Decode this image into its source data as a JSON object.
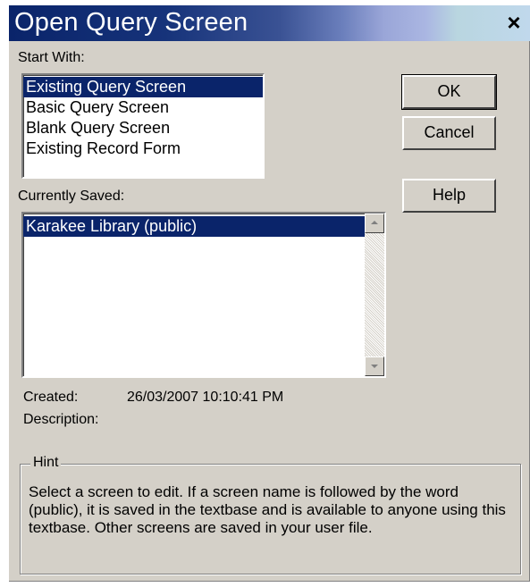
{
  "window": {
    "title": "Open Query Screen",
    "close_label": "×"
  },
  "start_with": {
    "label": "Start With:",
    "items": [
      {
        "label": "Existing Query Screen",
        "selected": true
      },
      {
        "label": "Basic Query Screen",
        "selected": false
      },
      {
        "label": "Blank Query Screen",
        "selected": false
      },
      {
        "label": "Existing Record Form",
        "selected": false
      }
    ]
  },
  "currently_saved": {
    "label": "Currently Saved:",
    "items": [
      {
        "label": "Karakee Library (public)",
        "selected": true
      }
    ]
  },
  "buttons": {
    "ok": "OK",
    "cancel": "Cancel",
    "help": "Help"
  },
  "details": {
    "created_label": "Created:",
    "created_value": "26/03/2007 10:10:41 PM",
    "description_label": "Description:"
  },
  "hint": {
    "legend": "Hint",
    "text": "Select a screen to edit. If a screen name is followed by the word (public), it is saved in the textbase and is available to anyone using this textbase. Other screens are saved in your user file."
  }
}
